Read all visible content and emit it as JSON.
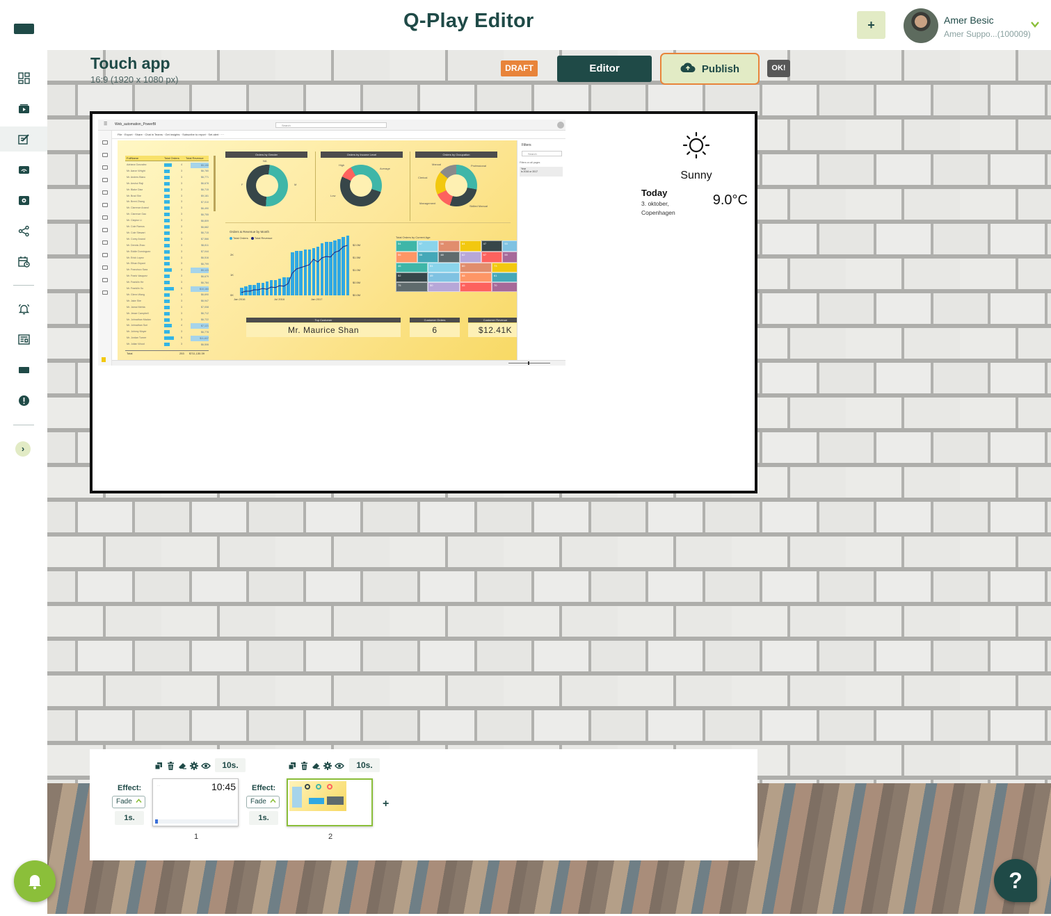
{
  "app": {
    "title": "Q-Play Editor",
    "add_label": "+"
  },
  "user": {
    "name": "Amer Besic",
    "account": "Amer Suppo...(100009)"
  },
  "nav": {
    "items": [
      {
        "name": "dashboard-icon"
      },
      {
        "name": "media-icon"
      },
      {
        "name": "editor-icon",
        "active": true
      },
      {
        "name": "screens-icon"
      },
      {
        "name": "playlist-icon"
      },
      {
        "name": "share-icon"
      },
      {
        "name": "schedule-icon"
      },
      {
        "name": "alerts-icon"
      },
      {
        "name": "news-icon"
      },
      {
        "name": "display-icon"
      },
      {
        "name": "warning-icon"
      }
    ],
    "expand_label": "›"
  },
  "project": {
    "title": "Touch app",
    "resolution": "16:9 (1920 x 1080 px)",
    "status": "DRAFT",
    "editor_label": "Editor",
    "publish_label": "Publish",
    "ok_label": "OK!"
  },
  "powerbi": {
    "file_name": "Web_automation_PowerBI",
    "search_placeholder": "Search",
    "toolbar": "File  ·  Export  ·  Share  ·  Chat in Teams  ·  Get insights  ·  Subscribe to report  ·  Set alert  ·  ···",
    "table_headers": [
      "FullName",
      "Total Orders",
      "Total Revenue"
    ],
    "rows": [
      [
        "Adriana Gonzalez",
        "4",
        "$9,190.49"
      ],
      [
        "Mr. Aaron Wright",
        "3",
        "$6,780.99"
      ],
      [
        "Mr. Andres Blanc",
        "3",
        "$6,771.49"
      ],
      [
        "Mr. Anshul Raji",
        "3",
        "$6,678.79"
      ],
      [
        "Mr. Blake Diaz",
        "3",
        "$6,715.96"
      ],
      [
        "Mr. Brad She",
        "3",
        "$9,181.97"
      ],
      [
        "Mr. Brent Zhang",
        "3",
        "$7,010.09"
      ],
      [
        "Mr. Clarence Anand",
        "3",
        "$6,490.02"
      ],
      [
        "Mr. Clarence Gao",
        "3",
        "$6,755.48"
      ],
      [
        "Mr. Clayton Li",
        "3",
        "$6,809.94"
      ],
      [
        "Mr. Cole Ramos",
        "3",
        "$6,682.41"
      ],
      [
        "Mr. Cole Stewart",
        "3",
        "$6,715.92"
      ],
      [
        "Mr. Corey Anand",
        "3",
        "$7,566.57"
      ],
      [
        "Mr. Dennis Zhao",
        "3",
        "$6,811.22"
      ],
      [
        "Mr. Eddie Dominguez",
        "3",
        "$7,044.36"
      ],
      [
        "Mr. Erick Lopez",
        "3",
        "$6,516.31"
      ],
      [
        "Mr. Ethan Bryant",
        "3",
        "$6,799.21"
      ],
      [
        "Mr. Francisco Sara",
        "4",
        "$9,123.06"
      ],
      [
        "Mr. Frank Vasquez",
        "3",
        "$6,679.35"
      ],
      [
        "Mr. Franklin He",
        "3",
        "$6,784.41"
      ],
      [
        "Mr. Franklin Xu",
        "5",
        "$10,184.24"
      ],
      [
        "Mr. Glenn Wang",
        "3",
        "$6,690.48"
      ],
      [
        "Mr. Jake She",
        "3",
        "$6,947.09"
      ],
      [
        "Mr. Jamal Mehta",
        "3",
        "$7,008.07"
      ],
      [
        "Mr. Jesse Campbell",
        "3",
        "$6,712.22"
      ],
      [
        "Mr. Johnathan Madan",
        "3",
        "$6,722.14"
      ],
      [
        "Mr. Johnathan Suri",
        "4",
        "$7,121.23"
      ],
      [
        "Mr. Johnny Moyer",
        "3",
        "$6,778.24"
      ],
      [
        "Mr. Jordan Turner",
        "5",
        "$11,637.99"
      ],
      [
        "Mr. Julian Wood",
        "3",
        "$6,506.42"
      ]
    ],
    "total_row": [
      "Total",
      "253",
      "$711,130.39"
    ],
    "donut_titles": [
      "Orders by Gender",
      "Orders by Income Level",
      "Orders by Occupation"
    ],
    "gender_labels": [
      "NA",
      "F",
      "M"
    ],
    "income_labels": [
      "High",
      "Average",
      "Low"
    ],
    "occupation_labels": [
      "Manual",
      "Professional",
      "Clerical",
      "Management",
      "Skilled Manual"
    ],
    "line_title": "Orders & Revenue by Month",
    "legend": [
      "Total Orders",
      "Total Revenue"
    ],
    "y_left": [
      "2K",
      "1K",
      "0K"
    ],
    "y_right": [
      "$2.0M",
      "$1.5M",
      "$1.0M",
      "$0.5M",
      "$0.0M"
    ],
    "x_ticks": [
      "Jan 2016",
      "Jul 2016",
      "Jan 2017"
    ],
    "treemap_title": "Total Orders by Current Age",
    "treemap": [
      "54",
      "57",
      "58",
      "64",
      "47",
      "53",
      "56",
      "55",
      "48",
      "62",
      "67",
      "59",
      "46",
      "51",
      "60",
      "73",
      "52",
      "49",
      "68",
      "61",
      "75",
      "50",
      "45",
      "70"
    ],
    "kpi": [
      {
        "caption": "Top Customer",
        "value": "Mr. Maurice Shan"
      },
      {
        "caption": "Customer Orders",
        "value": "6"
      },
      {
        "caption": "Customer Revenue",
        "value": "$12.41K"
      }
    ],
    "filters_title": "Filters",
    "filters_search": "Search",
    "filters_note": "Filters on all pages",
    "filter_year": "Year",
    "filter_year_value": "is 2016 or 2017",
    "colors": {
      "bar": "#2fa8e3",
      "line": "#1a237e",
      "teal": "#3fb6a8",
      "dark": "#374649",
      "red": "#fd625e",
      "yellow": "#f2c80f"
    }
  },
  "weather": {
    "condition": "Sunny",
    "today": "Today",
    "date": "3. oktober,",
    "city": "Copenhagen",
    "temperature": "9.0°C"
  },
  "timeline": {
    "slides": [
      {
        "number": "1",
        "duration": "10s.",
        "effect_label": "Effect:",
        "effect": "Fade",
        "transition": "1s.",
        "clock": "10:45"
      },
      {
        "number": "2",
        "duration": "10s.",
        "effect_label": "Effect:",
        "effect": "Fade",
        "transition": "1s."
      }
    ],
    "add_label": "+"
  },
  "help": {
    "label": "?"
  }
}
